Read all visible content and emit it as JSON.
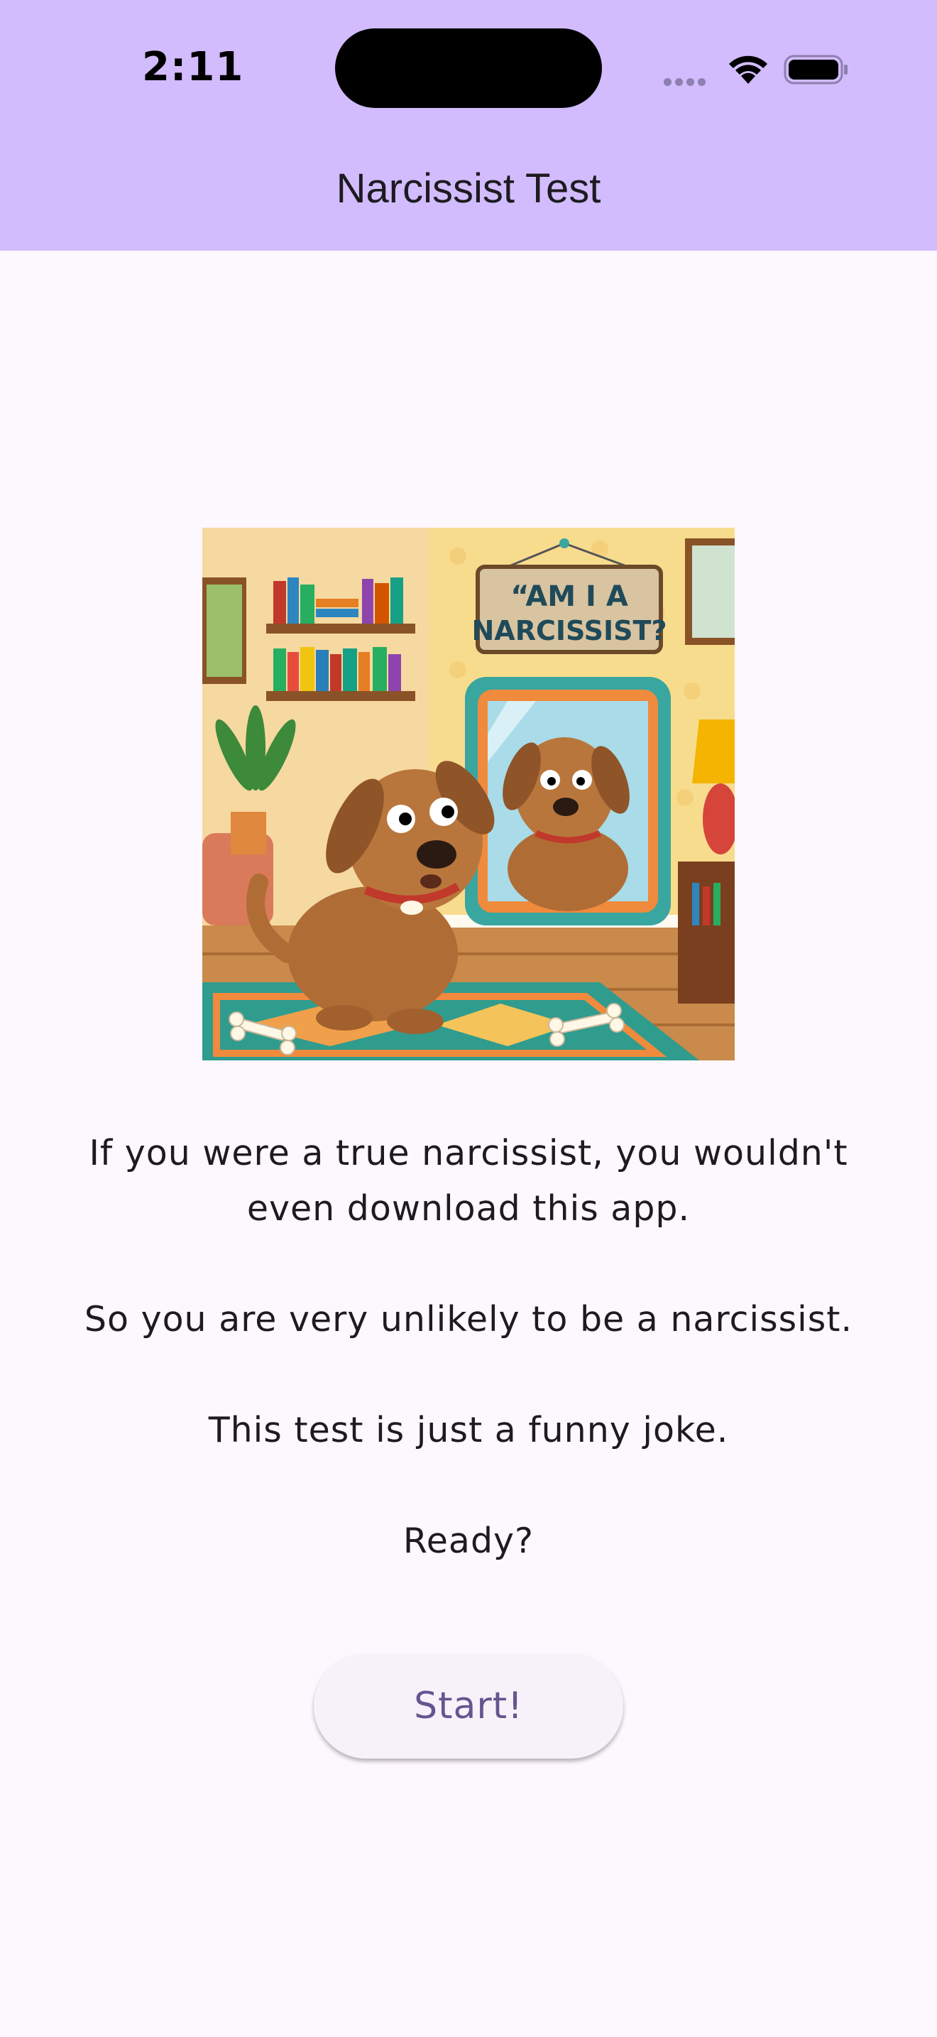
{
  "status_bar": {
    "time": "2:11",
    "icons": [
      "signal-dots-icon",
      "wifi-icon",
      "battery-icon"
    ]
  },
  "app_bar": {
    "title": "Narcissist Test",
    "background": "#d2bcfd"
  },
  "illustration": {
    "sign_line1": "“AM I A",
    "sign_line2": "NARCISSIST?"
  },
  "intro": {
    "line1": "If you were a true narcissist, you wouldn't even download this app.",
    "line2": "So you are very unlikely to be a narcissist.",
    "line3": "This test is just a funny joke.",
    "line4": "Ready?"
  },
  "start_button": {
    "label": "Start!"
  },
  "colors": {
    "background": "#fdf7fe",
    "accent": "#65558f"
  }
}
